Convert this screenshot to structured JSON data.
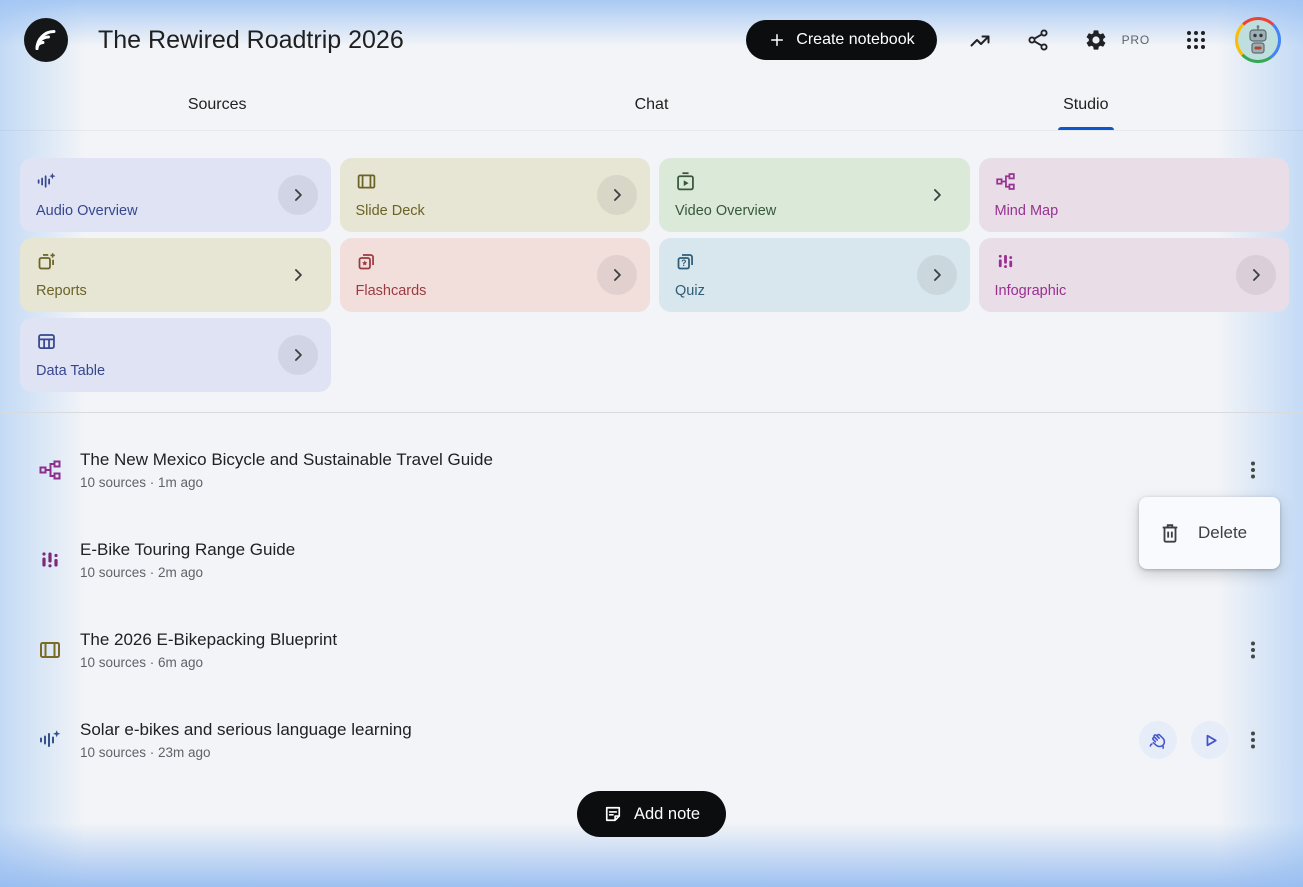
{
  "header": {
    "title": "The Rewired Roadtrip 2026",
    "create_notebook_label": "Create notebook",
    "pro_badge": "PRO",
    "icons": [
      "plus-icon",
      "analytics-icon",
      "share-icon",
      "settings-gear-icon",
      "apps-grid-icon",
      "user-avatar"
    ]
  },
  "tabs": {
    "items": [
      {
        "label": "Sources",
        "active": false
      },
      {
        "label": "Chat",
        "active": false
      },
      {
        "label": "Studio",
        "active": true
      }
    ],
    "active_indicator_color": "#0b57d0"
  },
  "studio_tools": [
    {
      "label": "Audio Overview",
      "icon": "audio-waveform-sparkle-icon",
      "bg": "#dfe3f4",
      "fg": "#37478f",
      "chevron": "circled"
    },
    {
      "label": "Slide Deck",
      "icon": "slide-deck-icon",
      "bg": "#e7e5d3",
      "fg": "#6b6325",
      "chevron": "circled"
    },
    {
      "label": "Video Overview",
      "icon": "video-overview-icon",
      "bg": "#dbe9d8",
      "fg": "#38573b",
      "chevron": "plain"
    },
    {
      "label": "Mind Map",
      "icon": "mind-map-icon",
      "bg": "#e9dde8",
      "fg": "#973390",
      "chevron": "none"
    },
    {
      "label": "Reports",
      "icon": "reports-icon",
      "bg": "#e7e5d3",
      "fg": "#6b6325",
      "chevron": "plain"
    },
    {
      "label": "Flashcards",
      "icon": "flashcards-icon",
      "bg": "#f2dfdc",
      "fg": "#9c3a41",
      "chevron": "circled"
    },
    {
      "label": "Quiz",
      "icon": "quiz-icon",
      "bg": "#d8e6ed",
      "fg": "#2f5d77",
      "chevron": "circled"
    },
    {
      "label": "Infographic",
      "icon": "infographic-icon",
      "bg": "#e9dde8",
      "fg": "#9a2f90",
      "chevron": "circled"
    },
    {
      "label": "Data Table",
      "icon": "data-table-icon",
      "bg": "#dfe3f4",
      "fg": "#37478f",
      "chevron": "circled"
    }
  ],
  "artifacts": [
    {
      "icon": "mind-map-icon",
      "color": "#8d2e8d",
      "title": "The New Mexico Bicycle and Sustainable Travel Guide",
      "meta": "10 sources · 1m ago"
    },
    {
      "icon": "infographic-icon",
      "color": "#7c2a78",
      "title": "E-Bike Touring Range Guide",
      "meta": "10 sources · 2m ago"
    },
    {
      "icon": "slide-deck-icon",
      "color": "#7a6c26",
      "title": "The 2026 E-Bikepacking Blueprint",
      "meta": "10 sources · 6m ago"
    },
    {
      "icon": "audio-waveform-sparkle-icon",
      "color": "#33518a",
      "title": "Solar e-bikes and serious language learning",
      "meta": "10 sources · 23m ago"
    }
  ],
  "context_menu": {
    "items": [
      {
        "label": "Delete",
        "icon": "trash-icon"
      }
    ]
  },
  "footer": {
    "add_note_label": "Add note"
  },
  "colors": {
    "accent_blue": "#0b57d0",
    "button_black": "#0c0d0f",
    "audio_control_blue": "#4355cc",
    "meta_gray": "#5f6368"
  }
}
